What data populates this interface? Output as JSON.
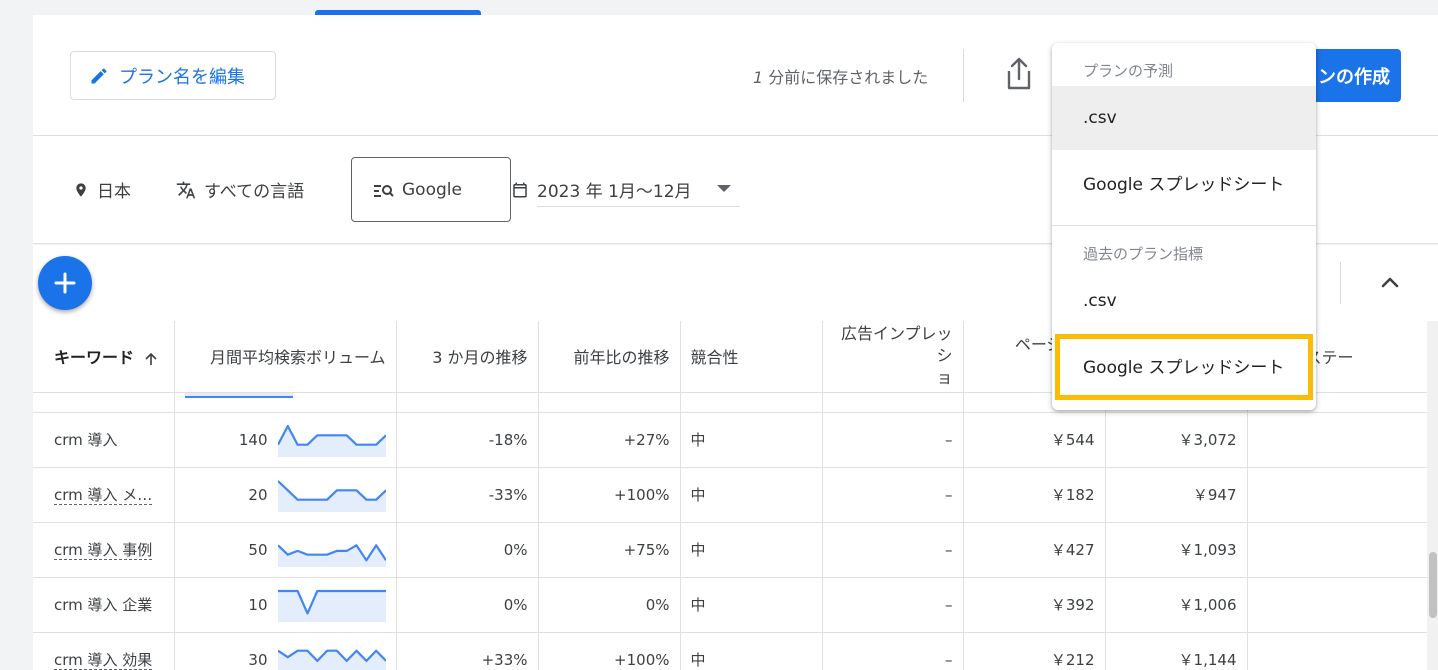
{
  "header": {
    "edit_label": "プラン名を編集",
    "saved_number": "1",
    "saved_text": " 分前に保存されました",
    "create_label": "ンの作成"
  },
  "filters": {
    "location": "日本",
    "language": "すべての言語",
    "network": "Google",
    "date_range": "2023 年 1月〜12月"
  },
  "table": {
    "columns": [
      "キーワード",
      "月間平均検索ボリューム",
      "3 か月の推移",
      "前年比の推移",
      "競合性",
      "広告インプレッシ\nョ",
      "ページ上部",
      "",
      "ントのステー"
    ],
    "rows": [
      {
        "keyword": "crm 導入",
        "volume": "140",
        "trend": [
          1,
          3,
          1,
          1,
          2,
          2,
          2,
          2,
          1,
          1,
          1,
          2
        ],
        "three_month": "-18%",
        "yoy": "+27%",
        "competition": "中",
        "impressions": "–",
        "top_low": "￥544",
        "top_high": "￥3,072",
        "status": "",
        "dashed": false
      },
      {
        "keyword": "crm 導入 メ…",
        "volume": "20",
        "trend": [
          3,
          2,
          1,
          1,
          1,
          1,
          2,
          2,
          2,
          1,
          1,
          2
        ],
        "three_month": "-33%",
        "yoy": "+100%",
        "competition": "中",
        "impressions": "–",
        "top_low": "￥182",
        "top_high": "￥947",
        "status": "",
        "dashed": true
      },
      {
        "keyword": "crm 導入 事例",
        "volume": "50",
        "trend": [
          2,
          1,
          1.4,
          1,
          1,
          1,
          1.4,
          1.4,
          2,
          0.4,
          2,
          0.4
        ],
        "three_month": "0%",
        "yoy": "+75%",
        "competition": "中",
        "impressions": "–",
        "top_low": "￥427",
        "top_high": "￥1,093",
        "status": "",
        "dashed": true
      },
      {
        "keyword": "crm 導入 企業",
        "volume": "10",
        "trend": [
          3,
          3,
          3,
          0.6,
          3,
          3,
          3,
          3,
          3,
          3,
          3,
          3
        ],
        "three_month": "0%",
        "yoy": "0%",
        "competition": "中",
        "impressions": "–",
        "top_low": "￥392",
        "top_high": "￥1,006",
        "status": "",
        "dashed": false
      },
      {
        "keyword": "crm 導入 効果",
        "volume": "30",
        "trend": [
          2.5,
          1.8,
          2.5,
          2.5,
          1.4,
          2.5,
          2.5,
          1.4,
          2.5,
          1.4,
          2.5,
          1.4
        ],
        "three_month": "+33%",
        "yoy": "+100%",
        "competition": "中",
        "impressions": "–",
        "top_low": "￥212",
        "top_high": "￥1,144",
        "status": "",
        "dashed": true
      }
    ]
  },
  "menu": {
    "section1_heading": "プランの予測",
    "section1_items": [
      ".csv",
      "Google スプレッドシート"
    ],
    "section2_heading": "過去のプラン指標",
    "section2_items": [
      ".csv",
      "Google スプレッドシート"
    ]
  },
  "colors": {
    "accent": "#1a73e8",
    "highlight": "#fbbc04",
    "sparkline_line": "#4285f4",
    "sparkline_fill": "#e3edfc"
  },
  "icons": {
    "edit": "pencil-icon",
    "share": "share-icon",
    "location": "location-pin-icon",
    "language": "translate-icon",
    "network": "search-network-icon",
    "calendar": "calendar-icon",
    "add": "plus-icon",
    "collapse": "chevron-up-icon",
    "sort": "arrow-up-icon"
  }
}
